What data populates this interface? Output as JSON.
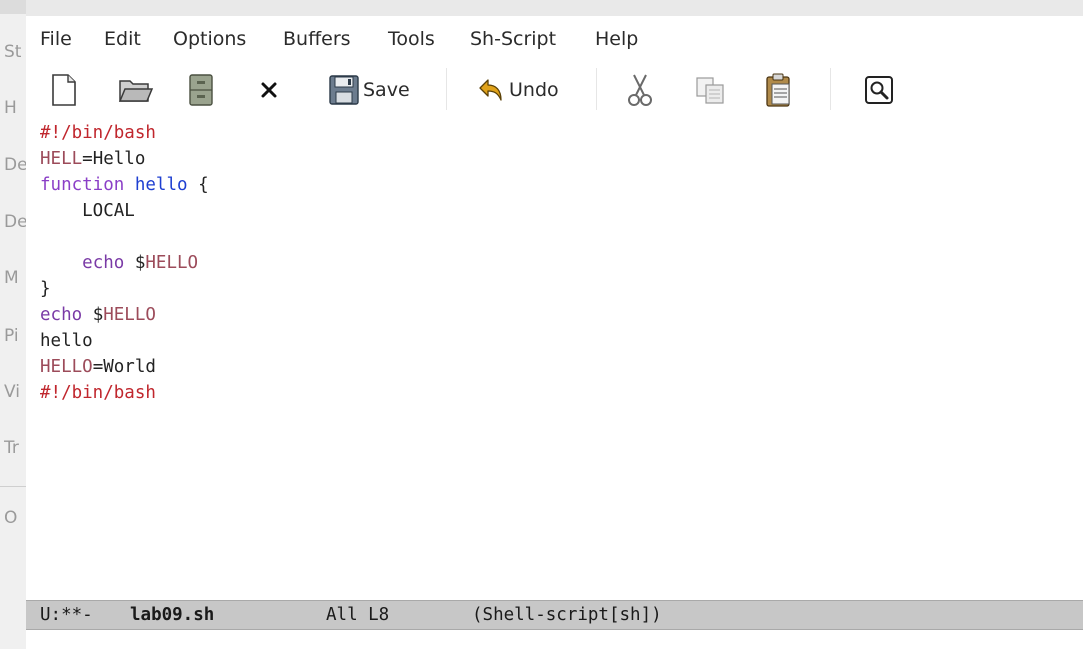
{
  "background_window": {
    "letters": [
      "St",
      "H",
      "De",
      "De",
      "M",
      "Pi",
      "Vi",
      "Tr",
      "O"
    ]
  },
  "menubar": {
    "items": [
      "File",
      "Edit",
      "Options",
      "Buffers",
      "Tools",
      "Sh-Script",
      "Help"
    ]
  },
  "toolbar": {
    "new_icon": "new-file-icon",
    "open_icon": "open-folder-icon",
    "dired_icon": "file-cabinet-icon",
    "close_icon": "close-icon",
    "save_label": "Save",
    "undo_label": "Undo",
    "cut_icon": "scissors-icon",
    "copy_icon": "copy-icon",
    "paste_icon": "clipboard-icon",
    "search_icon": "search-icon"
  },
  "editor": {
    "lines": [
      {
        "segments": [
          {
            "text": "#!/bin/bash",
            "cls": "c-comment"
          }
        ]
      },
      {
        "segments": [
          {
            "text": "HELL",
            "cls": "c-var"
          },
          {
            "text": "=Hello",
            "cls": ""
          }
        ]
      },
      {
        "segments": [
          {
            "text": "function",
            "cls": "c-kw"
          },
          {
            "text": " ",
            "cls": ""
          },
          {
            "text": "hello",
            "cls": "c-fn"
          },
          {
            "text": " {",
            "cls": ""
          }
        ]
      },
      {
        "segments": [
          {
            "text": "    LOCAL",
            "cls": ""
          }
        ]
      },
      {
        "segments": [
          {
            "text": "",
            "cls": ""
          }
        ]
      },
      {
        "segments": [
          {
            "text": "    ",
            "cls": ""
          },
          {
            "text": "echo",
            "cls": "c-builtin"
          },
          {
            "text": " $",
            "cls": ""
          },
          {
            "text": "HELLO",
            "cls": "c-var"
          }
        ]
      },
      {
        "segments": [
          {
            "text": "}",
            "cls": ""
          }
        ]
      },
      {
        "segments": [
          {
            "text": "echo",
            "cls": "c-builtin"
          },
          {
            "text": " $",
            "cls": ""
          },
          {
            "text": "HELLO",
            "cls": "c-var"
          }
        ]
      },
      {
        "segments": [
          {
            "text": "hello",
            "cls": ""
          }
        ]
      },
      {
        "segments": [
          {
            "text": "HELLO",
            "cls": "c-var"
          },
          {
            "text": "=World",
            "cls": ""
          }
        ]
      },
      {
        "segments": [
          {
            "text": "#!/bin/bash",
            "cls": "c-comment"
          }
        ]
      }
    ]
  },
  "modeline": {
    "status": "U:**-",
    "buffer_name": "lab09.sh",
    "position": "All L8",
    "mode": "(Shell-script[sh])"
  },
  "colors": {
    "comment": "#c0262d",
    "variable": "#9c4b5a",
    "keyword": "#8b3fc7",
    "function_name": "#1e3fd1",
    "modeline_bg": "#c7c7c7"
  }
}
